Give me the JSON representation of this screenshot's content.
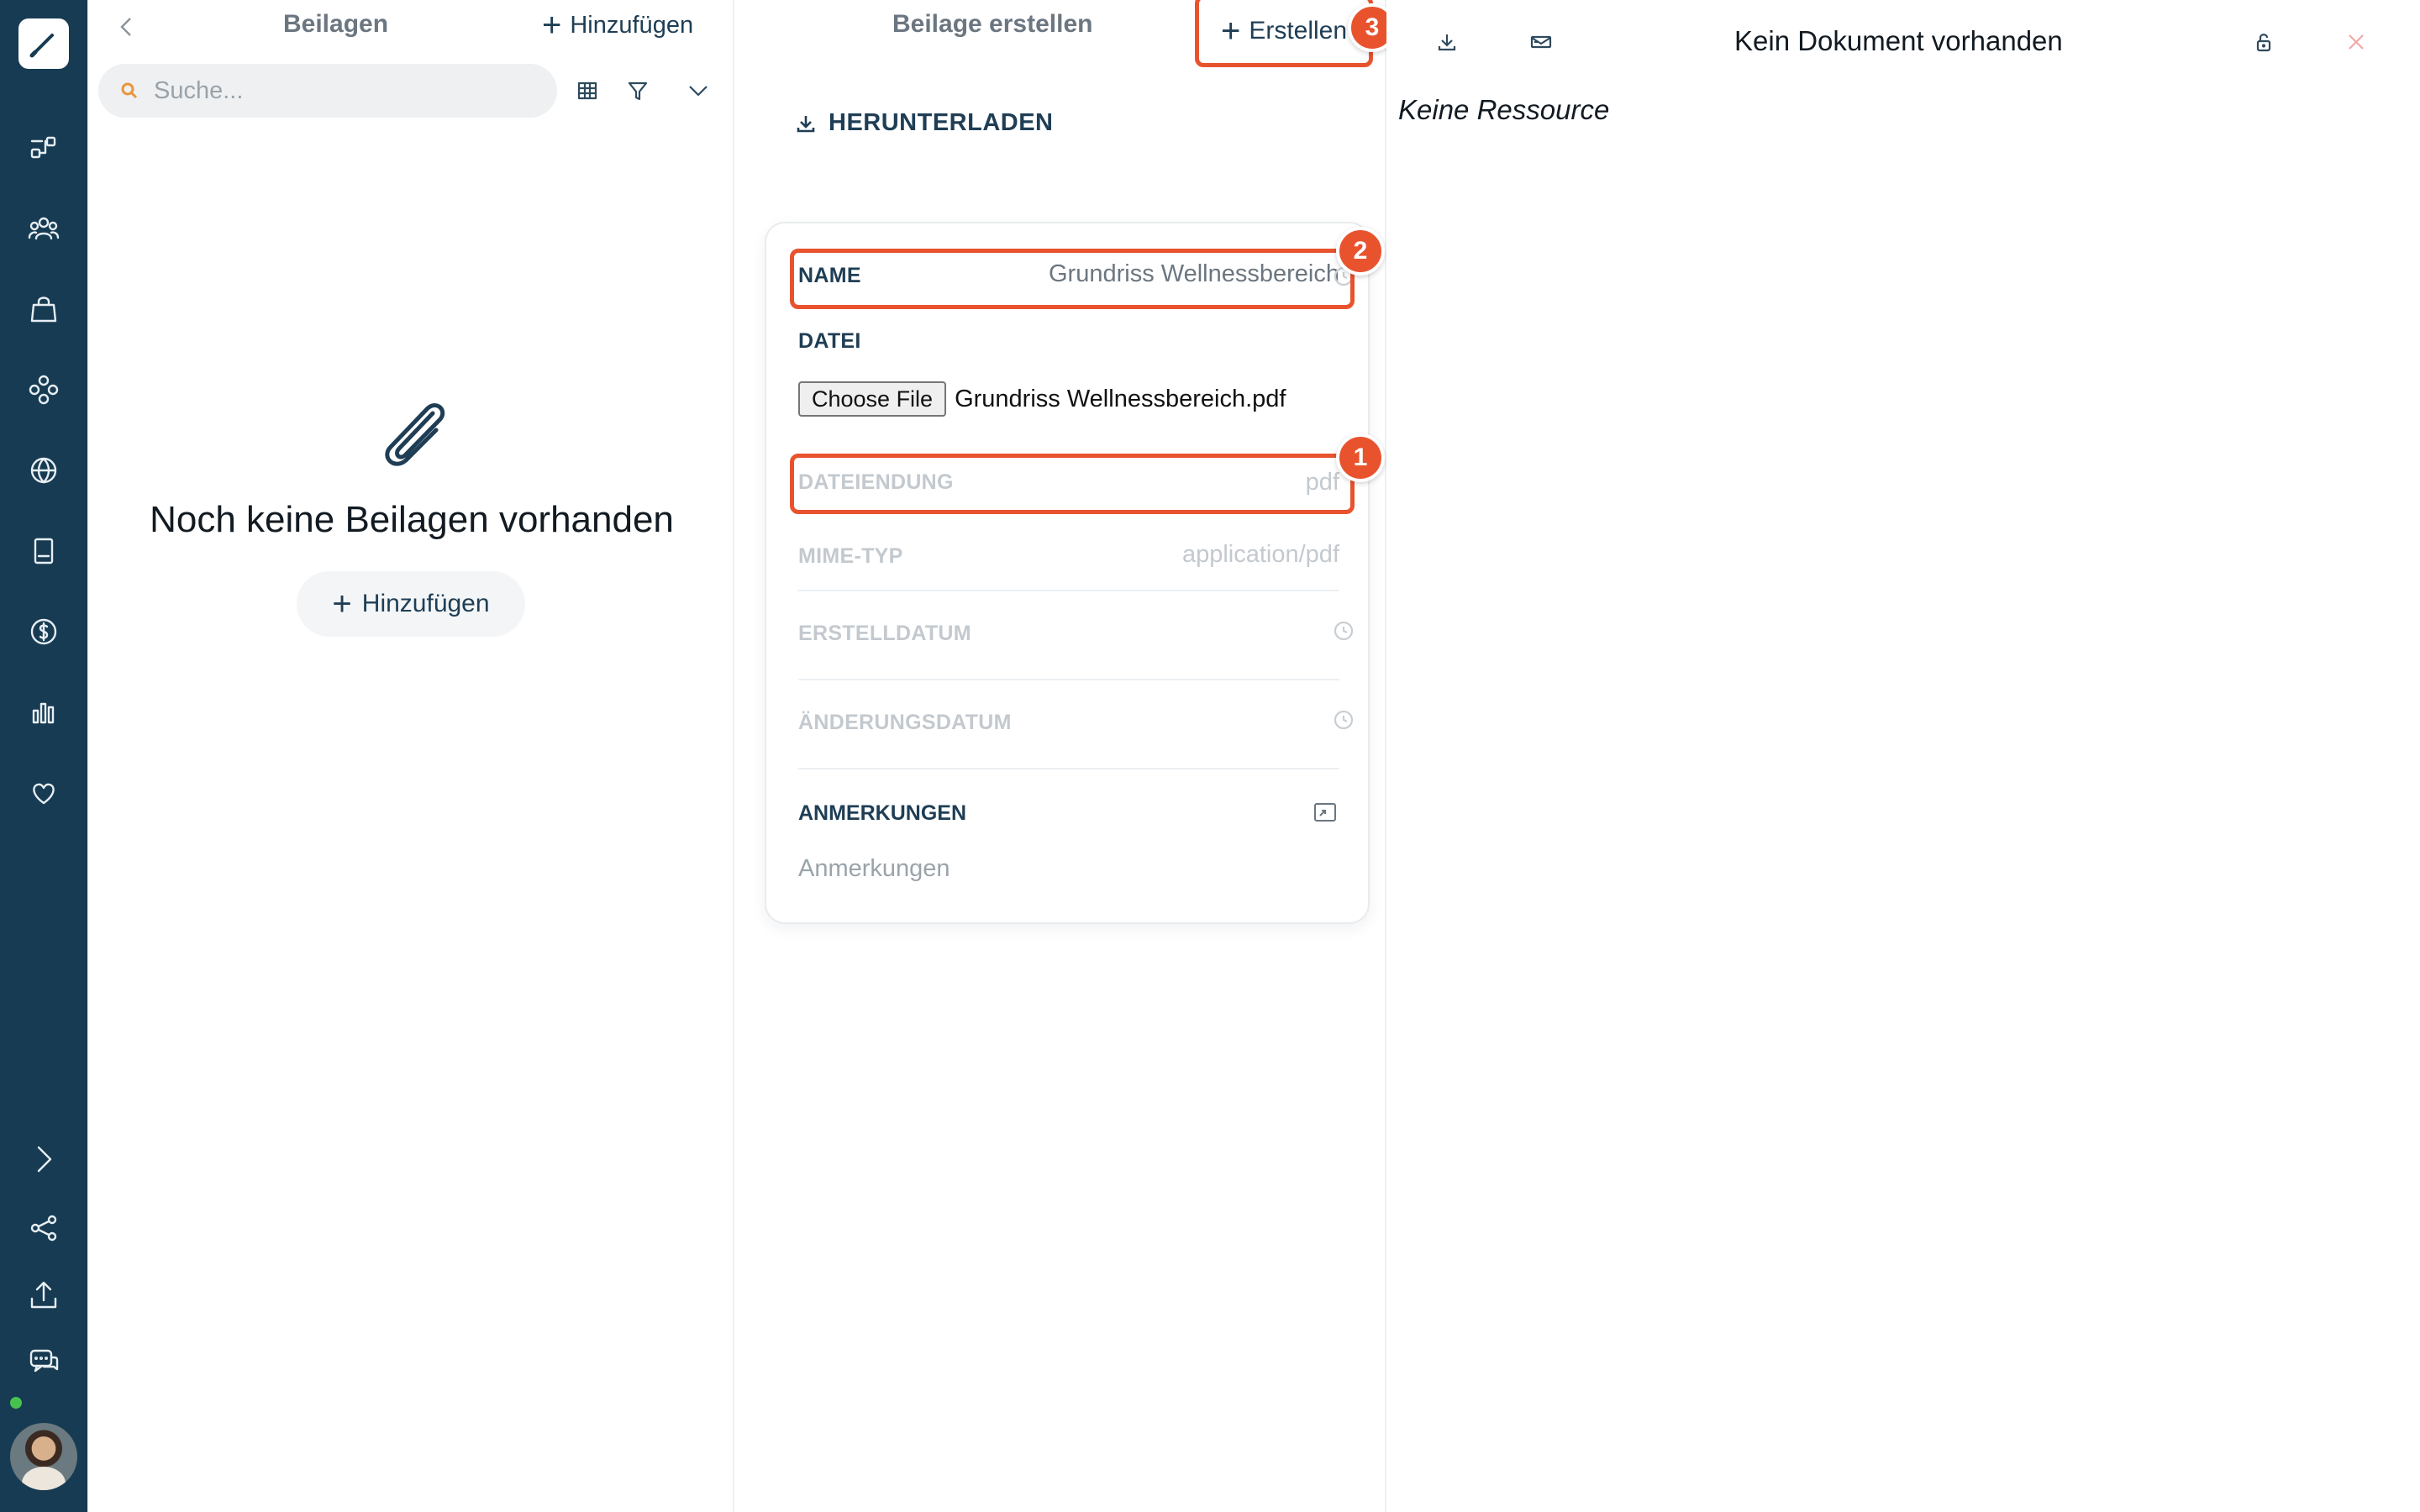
{
  "nav": {
    "items": [
      "pen-logo-icon",
      "workflow-icon",
      "people-icon",
      "bag-icon",
      "modules-icon",
      "globe-icon",
      "book-icon",
      "dollar-icon",
      "chart-icon",
      "heart-icon",
      "expand-icon",
      "share-icon",
      "upload-icon",
      "chat-icon"
    ],
    "online_color": "#48c24f"
  },
  "list_panel": {
    "title": "Beilagen",
    "add_label": "Hinzufügen",
    "search_placeholder": "Suche...",
    "empty_title": "Noch keine Beilagen vorhanden",
    "empty_add_label": "Hinzufügen"
  },
  "form_panel": {
    "title": "Beilage erstellen",
    "create_label": "Erstellen",
    "download_label": "HERUNTERLADEN",
    "fields": {
      "name": {
        "label": "NAME",
        "value": "Grundriss Wellnessbereich"
      },
      "file": {
        "label": "DATEI",
        "button": "Choose File",
        "filename": "Grundriss Wellnessbereich.pdf"
      },
      "extension": {
        "label": "DATEIENDUNG",
        "value": "pdf"
      },
      "mime": {
        "label": "MIME-TYP",
        "value": "application/pdf"
      },
      "created": {
        "label": "ERSTELLDATUM",
        "value": ""
      },
      "modified": {
        "label": "ÄNDERUNGSDATUM",
        "value": ""
      },
      "notes": {
        "label": "ANMERKUNGEN",
        "placeholder": "Anmerkungen"
      }
    }
  },
  "doc_panel": {
    "title": "Kein Dokument vorhanden",
    "empty_text": "Keine Ressource"
  },
  "annotations": {
    "badge_1": "1",
    "badge_2": "2",
    "badge_3": "3",
    "color": "#e8532e"
  },
  "colors": {
    "rail": "#173b52",
    "accent_text": "#1f3e55",
    "highlight": "#e8532e",
    "close": "#f2a7a7"
  }
}
